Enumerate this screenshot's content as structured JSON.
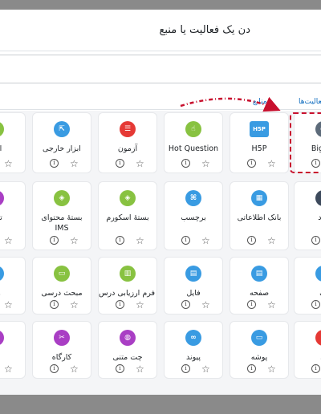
{
  "dialog": {
    "title": "دن یک فعالیت یا منبع",
    "search_placeholder": "",
    "tabs": [
      {
        "label": "فعالیت‌ها"
      },
      {
        "label": "منابع"
      }
    ]
  },
  "rows": [
    {
      "items": [
        {
          "label": "BigBlu",
          "icon": "bigbluebutton-icon",
          "color": "#5d6b7a",
          "glyph": "●"
        },
        {
          "label": "H5P",
          "icon": "h5p-icon",
          "color": "#399be2",
          "glyph": "H5P"
        },
        {
          "label": "Hot Question",
          "icon": "hot-question-icon",
          "color": "#88c241",
          "glyph": "☝"
        },
        {
          "label": "آزمون",
          "icon": "quiz-icon",
          "color": "#e53935",
          "glyph": "☰"
        },
        {
          "label": "ابزار خارجی",
          "icon": "external-tool-icon",
          "color": "#399be2",
          "glyph": "⇱"
        },
        {
          "label": "انت",
          "icon": "choice-icon",
          "color": "#88c241",
          "glyph": "✓"
        }
      ]
    },
    {
      "items": [
        {
          "label": "ورد",
          "icon": "database-entry-icon",
          "color": "#3d4a5c",
          "glyph": "⌂"
        },
        {
          "label": "بانک اطلاعاتی",
          "icon": "database-icon",
          "color": "#399be2",
          "glyph": "▦"
        },
        {
          "label": "برچسب",
          "icon": "label-icon",
          "color": "#399be2",
          "glyph": "⌘"
        },
        {
          "label": "بستهٔ اسکورم",
          "icon": "scorm-package-icon",
          "color": "#88c241",
          "glyph": "◈"
        },
        {
          "label": "بستهٔ محتوای",
          "label2": "IMS",
          "icon": "ims-package-icon",
          "color": "#88c241",
          "glyph": "◈"
        },
        {
          "label": "تالار",
          "icon": "forum-icon",
          "color": "#a93ec4",
          "glyph": "✉"
        }
      ]
    },
    {
      "items": [
        {
          "label": "ف",
          "icon": "glossary-icon",
          "color": "#399be2",
          "glyph": "≡"
        },
        {
          "label": "صفحه",
          "icon": "page-icon",
          "color": "#399be2",
          "glyph": "▤"
        },
        {
          "label": "فایل",
          "icon": "file-icon",
          "color": "#399be2",
          "glyph": "▤"
        },
        {
          "label": "فرم ارزیابی درس",
          "icon": "feedback-icon",
          "color": "#88c241",
          "glyph": "▥"
        },
        {
          "label": "مبحث درسی",
          "icon": "lesson-icon",
          "color": "#88c241",
          "glyph": "▭"
        },
        {
          "label": "واژ",
          "icon": "wiki-icon",
          "color": "#399be2",
          "glyph": "≡"
        }
      ]
    },
    {
      "items": [
        {
          "label": "ی",
          "icon": "assignment-icon",
          "color": "#e53935",
          "glyph": "✎"
        },
        {
          "label": "پوشه",
          "icon": "folder-icon",
          "color": "#399be2",
          "glyph": "▭"
        },
        {
          "label": "پیوند",
          "icon": "url-link-icon",
          "color": "#399be2",
          "glyph": "∞"
        },
        {
          "label": "چت متنی",
          "icon": "chat-icon",
          "color": "#a93ec4",
          "glyph": "◍"
        },
        {
          "label": "کارگاه",
          "icon": "workshop-icon",
          "color": "#a93ec4",
          "glyph": "✂"
        },
        {
          "label": "ک",
          "icon": "collaborate-icon",
          "color": "#a93ec4",
          "glyph": "✦"
        }
      ]
    }
  ],
  "common": {
    "info_glyph": "i",
    "star_glyph": "☆"
  },
  "highlight_color": "#c8102e"
}
